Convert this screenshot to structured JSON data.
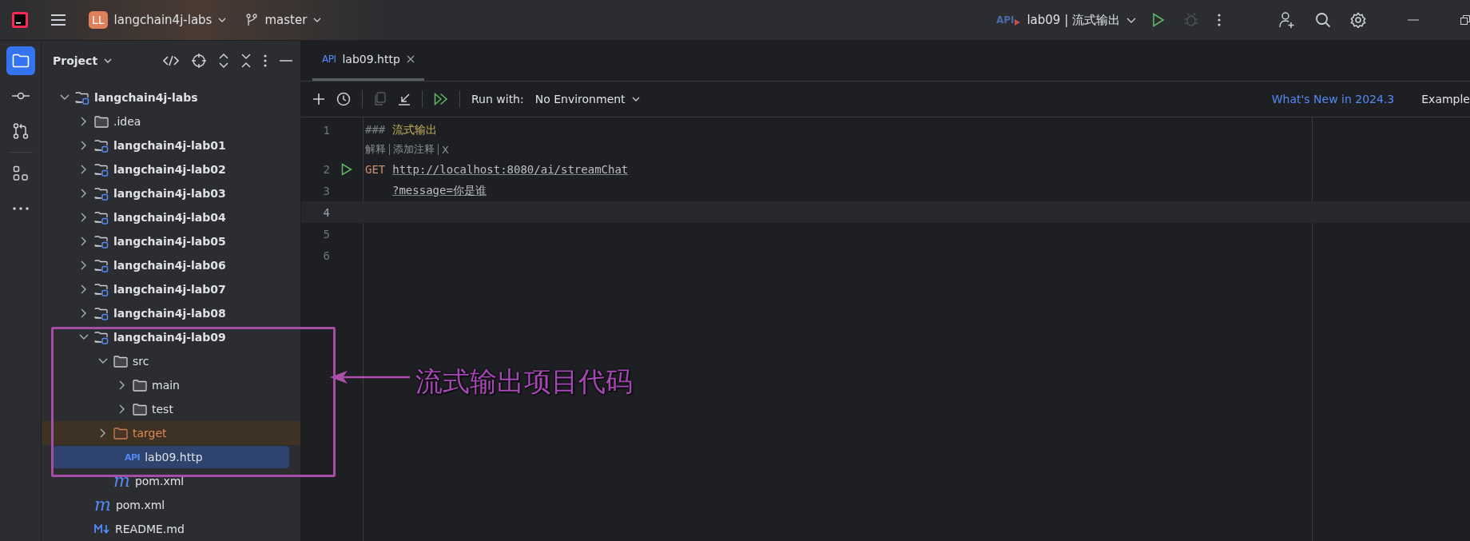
{
  "title_bar": {
    "project_badge": "LL",
    "project_name": "langchain4j-labs",
    "branch": "master",
    "run_config_icon": "API",
    "run_config": "lab09 | 流式输出",
    "debug_disabled": true
  },
  "sidebar": {
    "items": [
      {
        "kind": "folder",
        "selected": true
      },
      {
        "kind": "commit",
        "selected": false
      },
      {
        "kind": "pull-requests",
        "selected": false
      },
      {
        "kind": "structure",
        "selected": false
      },
      {
        "kind": "more",
        "selected": false
      }
    ]
  },
  "project_panel": {
    "title": "Project",
    "tree": [
      {
        "name": "langchain4j-labs",
        "kind": "module",
        "expanded": true,
        "selected": false,
        "children": [
          {
            "name": ".idea",
            "kind": "folder",
            "expanded": false,
            "selected": false
          },
          {
            "name": "langchain4j-lab01",
            "kind": "module",
            "expanded": false,
            "selected": false
          },
          {
            "name": "langchain4j-lab02",
            "kind": "module",
            "expanded": false,
            "selected": false
          },
          {
            "name": "langchain4j-lab03",
            "kind": "module",
            "expanded": false,
            "selected": false
          },
          {
            "name": "langchain4j-lab04",
            "kind": "module",
            "expanded": false,
            "selected": false
          },
          {
            "name": "langchain4j-lab05",
            "kind": "module",
            "expanded": false,
            "selected": false
          },
          {
            "name": "langchain4j-lab06",
            "kind": "module",
            "expanded": false,
            "selected": false
          },
          {
            "name": "langchain4j-lab07",
            "kind": "module",
            "expanded": false,
            "selected": false
          },
          {
            "name": "langchain4j-lab08",
            "kind": "module",
            "expanded": false,
            "selected": false
          },
          {
            "name": "langchain4j-lab09",
            "kind": "module",
            "expanded": true,
            "selected": false,
            "children": [
              {
                "name": "src",
                "kind": "folder",
                "expanded": true,
                "selected": false,
                "children": [
                  {
                    "name": "main",
                    "kind": "folder",
                    "expanded": false,
                    "selected": false
                  },
                  {
                    "name": "test",
                    "kind": "folder",
                    "expanded": false,
                    "selected": false
                  }
                ]
              },
              {
                "name": "target",
                "kind": "excluded",
                "expanded": false,
                "selected": false
              },
              {
                "name": "lab09.http",
                "kind": "http",
                "icon_text": "API",
                "selected": true
              },
              {
                "name": "pom.xml",
                "kind": "maven",
                "icon_text": "m",
                "selected": false
              }
            ]
          },
          {
            "name": "pom.xml",
            "kind": "maven",
            "icon_text": "m",
            "selected": false
          },
          {
            "name": "README.md",
            "kind": "markdown",
            "selected": false
          }
        ]
      }
    ]
  },
  "editor_tabs": [
    {
      "badge": "API",
      "label": "lab09.http",
      "selected": true
    }
  ],
  "toolbar": {
    "run_with_label": "Run with:",
    "environment": "No Environment",
    "whats_new": "What's New in 2024.3",
    "examples": "Example",
    "copy_disabled": true
  },
  "lines": [
    {
      "number": "1",
      "current": false,
      "run": false,
      "segments": [
        {
          "kind": "comment",
          "text": "###"
        },
        {
          "kind": "title",
          "text": "流式输出"
        }
      ],
      "hint": [
        "解释",
        "添加注释",
        "X"
      ]
    },
    {
      "number": "2",
      "current": false,
      "run": true,
      "segments": [
        {
          "kind": "keyword",
          "text": "GET"
        },
        {
          "kind": "url",
          "text": "http://localhost:8080/ai/streamChat"
        }
      ]
    },
    {
      "number": "3",
      "current": false,
      "run": false,
      "segments": [
        {
          "kind": "indent-url",
          "text": "?message=你是谁"
        }
      ]
    },
    {
      "number": "4",
      "current": true,
      "run": false
    },
    {
      "number": "5",
      "current": false,
      "run": false
    },
    {
      "number": "6",
      "current": false,
      "run": false
    }
  ],
  "annotation": {
    "label": "流式输出项目代码"
  }
}
